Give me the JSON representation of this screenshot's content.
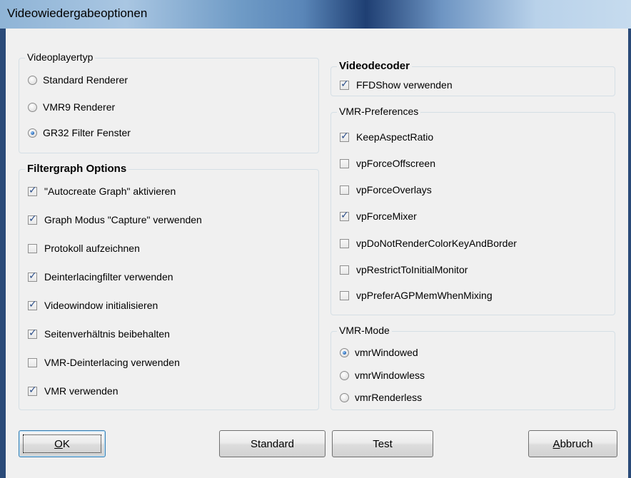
{
  "window": {
    "title": "Videowiedergabeoptionen"
  },
  "videoplayertyp": {
    "legend": "Videoplayertyp",
    "options": [
      {
        "label": "Standard Renderer",
        "checked": false
      },
      {
        "label": "VMR9 Renderer",
        "checked": false
      },
      {
        "label": "GR32 Filter Fenster",
        "checked": true
      }
    ]
  },
  "filtergraph": {
    "legend": "Filtergraph Options",
    "options": [
      {
        "label": "\"Autocreate Graph\" aktivieren",
        "checked": true
      },
      {
        "label": "Graph Modus \"Capture\" verwenden",
        "checked": true
      },
      {
        "label": "Protokoll aufzeichnen",
        "checked": false
      },
      {
        "label": "Deinterlacingfilter verwenden",
        "checked": true
      },
      {
        "label": "Videowindow initialisieren",
        "checked": true
      },
      {
        "label": "Seitenverhältnis beibehalten",
        "checked": true
      },
      {
        "label": "VMR-Deinterlacing verwenden",
        "checked": false
      },
      {
        "label": "VMR verwenden",
        "checked": true
      }
    ]
  },
  "videodecoder": {
    "legend": "Videodecoder",
    "options": [
      {
        "label": "FFDShow verwenden",
        "checked": true
      }
    ]
  },
  "vmr_preferences": {
    "legend": "VMR-Preferences",
    "options": [
      {
        "label": "KeepAspectRatio",
        "checked": true
      },
      {
        "label": "vpForceOffscreen",
        "checked": false
      },
      {
        "label": "vpForceOverlays",
        "checked": false
      },
      {
        "label": "vpForceMixer",
        "checked": true
      },
      {
        "label": "vpDoNotRenderColorKeyAndBorder",
        "checked": false
      },
      {
        "label": "vpRestrictToInitialMonitor",
        "checked": false
      },
      {
        "label": "vpPreferAGPMemWhenMixing",
        "checked": false
      }
    ]
  },
  "vmr_mode": {
    "legend": "VMR-Mode",
    "options": [
      {
        "label": "vmrWindowed",
        "checked": true
      },
      {
        "label": "vmrWindowless",
        "checked": false
      },
      {
        "label": "vmrRenderless",
        "checked": false
      }
    ]
  },
  "buttons": {
    "ok": {
      "mnemonic": "O",
      "rest": "K"
    },
    "standard": "Standard",
    "test": "Test",
    "abbruch": {
      "mnemonic": "A",
      "rest": "bbruch"
    }
  }
}
